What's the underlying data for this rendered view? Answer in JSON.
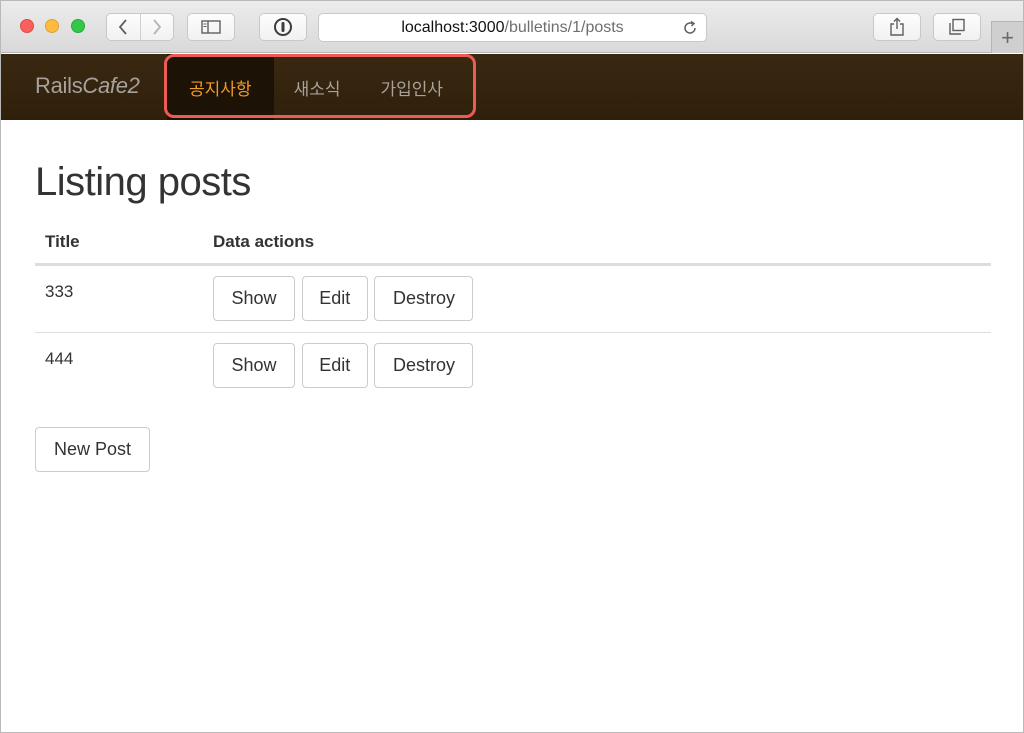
{
  "browser": {
    "url_host": "localhost:3000",
    "url_path": "/bulletins/1/posts",
    "icons": {
      "back": "chevron-left-icon",
      "forward": "chevron-right-icon",
      "sidebar": "sidebar-icon",
      "password": "password-key-icon",
      "reload": "reload-icon",
      "share": "share-icon",
      "tabs": "tabs-overview-icon",
      "new_tab": "plus-icon"
    },
    "new_tab_glyph": "+"
  },
  "navbar": {
    "brand_plain": "Rails",
    "brand_italic": "Cafe2",
    "links": [
      {
        "label": "공지사항",
        "active": true
      },
      {
        "label": "새소식",
        "active": false
      },
      {
        "label": "가입인사",
        "active": false
      }
    ],
    "colors": {
      "background": "#35240f",
      "active_text": "#f39a22",
      "highlight_border": "#ee5a55"
    }
  },
  "page": {
    "heading": "Listing posts",
    "table": {
      "headers": [
        "Title",
        "Data actions"
      ],
      "rows": [
        {
          "title": "333",
          "actions": [
            "Show",
            "Edit",
            "Destroy"
          ]
        },
        {
          "title": "444",
          "actions": [
            "Show",
            "Edit",
            "Destroy"
          ]
        }
      ]
    },
    "new_post_label": "New Post"
  }
}
